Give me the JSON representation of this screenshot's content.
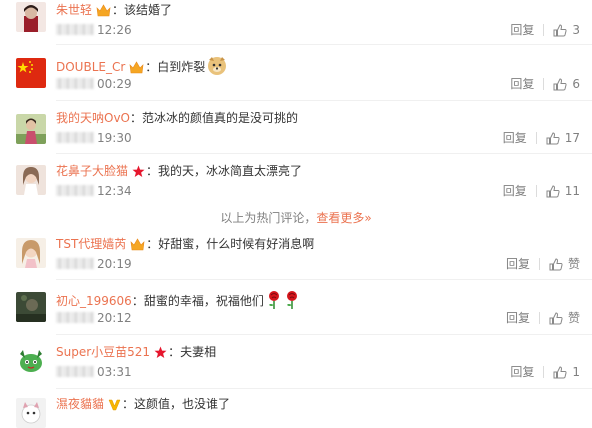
{
  "comments": [
    {
      "user": "朱世轻",
      "text": "该结婚了",
      "time": "12:26",
      "reply": "回复",
      "likes": "3"
    },
    {
      "user": "DOUBLE_Cr",
      "text": "白到炸裂",
      "time": "00:29",
      "reply": "回复",
      "likes": "6"
    },
    {
      "user": "我的天呐OvO",
      "text": "范冰冰的颜值真的是没可挑的",
      "time": "19:30",
      "reply": "回复",
      "likes": "17"
    },
    {
      "user": "花鼻子大脸猫",
      "text": "我的天，冰冰简直太漂亮了",
      "time": "12:34",
      "reply": "回复",
      "likes": "11"
    },
    {
      "user": "TST代理嫱芮",
      "text": "好甜蜜，什么时候有好消息啊",
      "time": "20:19",
      "reply": "回复",
      "likes": "赞"
    },
    {
      "user": "初心_199606",
      "text": "甜蜜的幸福，祝福他们",
      "time": "20:12",
      "reply": "回复",
      "likes": "赞"
    },
    {
      "user": "Super小豆苗521",
      "text": "夫妻相",
      "time": "03:31",
      "reply": "回复",
      "likes": "1"
    },
    {
      "user": "濕夜貓貓",
      "text": "这颜值，也没谁了",
      "time": "",
      "reply": "",
      "likes": ""
    }
  ],
  "hot_notice": {
    "text": "以上为热门评论，",
    "link": "查看更多»"
  },
  "colors": {
    "username": "#eb7350",
    "meta": "#808080",
    "text": "#333333"
  },
  "icons": {
    "like": "thumbs-up-icon",
    "vip": "vip-crown-icon",
    "star": "red-star-icon",
    "verified": "yellow-v-icon"
  }
}
